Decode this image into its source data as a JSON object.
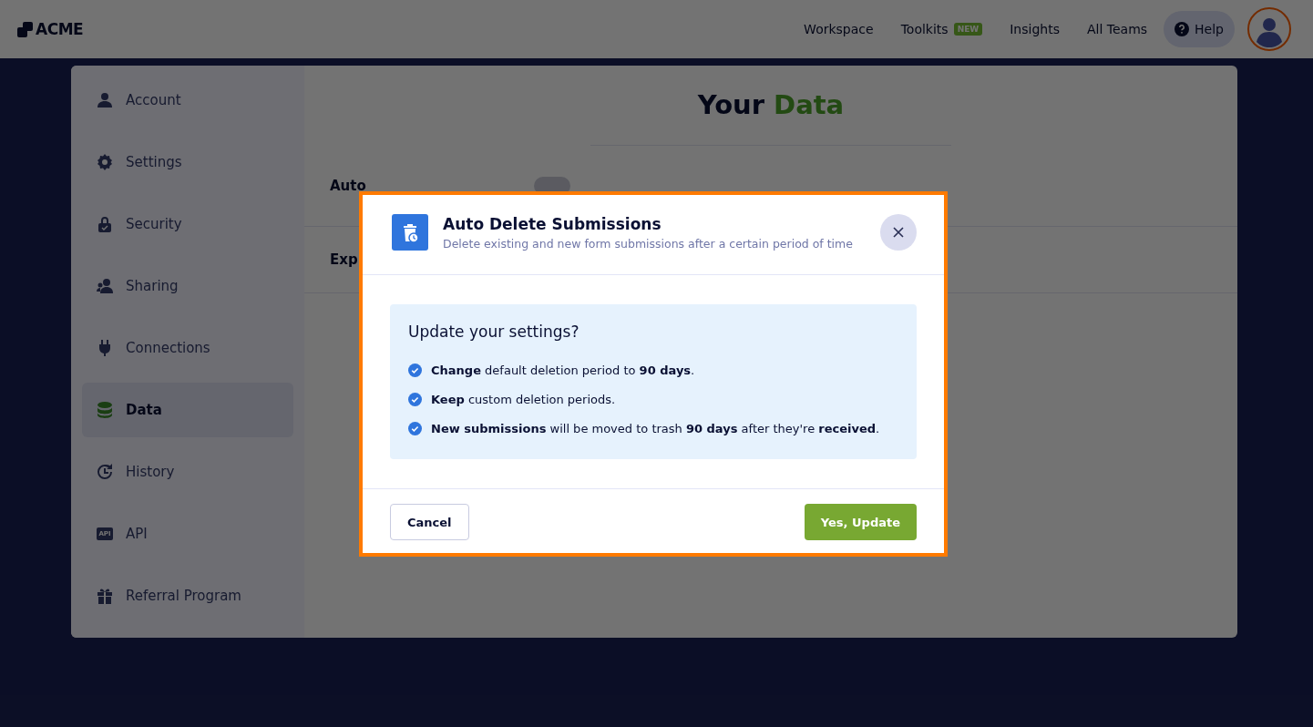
{
  "header": {
    "logo": "ACME",
    "nav": [
      {
        "label": "Workspace"
      },
      {
        "label": "Toolkits",
        "badge": "NEW"
      },
      {
        "label": "Insights"
      },
      {
        "label": "All Teams"
      }
    ],
    "help": "Help"
  },
  "sidebar": {
    "items": [
      {
        "label": "Account",
        "selected": false
      },
      {
        "label": "Settings",
        "selected": false
      },
      {
        "label": "Security",
        "selected": false
      },
      {
        "label": "Sharing",
        "selected": false
      },
      {
        "label": "Connections",
        "selected": false
      },
      {
        "label": "Data",
        "selected": true
      },
      {
        "label": "History",
        "selected": false
      },
      {
        "label": "API",
        "icon_label": "API",
        "selected": false
      },
      {
        "label": "Referral Program",
        "selected": false
      }
    ]
  },
  "page": {
    "title": "Your **Data**",
    "rows": [
      {
        "label": "Auto",
        "on": false
      },
      {
        "label": "Exp"
      }
    ]
  },
  "dialog": {
    "title": "Auto Delete Submissions",
    "subtitle": "Delete existing and new form submissions after a certain period of time",
    "question": "Update your settings?",
    "items": [
      "**Change** default deletion period to **90 days**.",
      "**Keep** custom deletion periods.",
      "**New submissions** will be moved to trash **90 days** after they're **received**."
    ],
    "buttons": [
      {
        "label": "Cancel",
        "kind": "secondary"
      },
      {
        "label": "Yes, Update",
        "kind": "primary"
      }
    ]
  }
}
